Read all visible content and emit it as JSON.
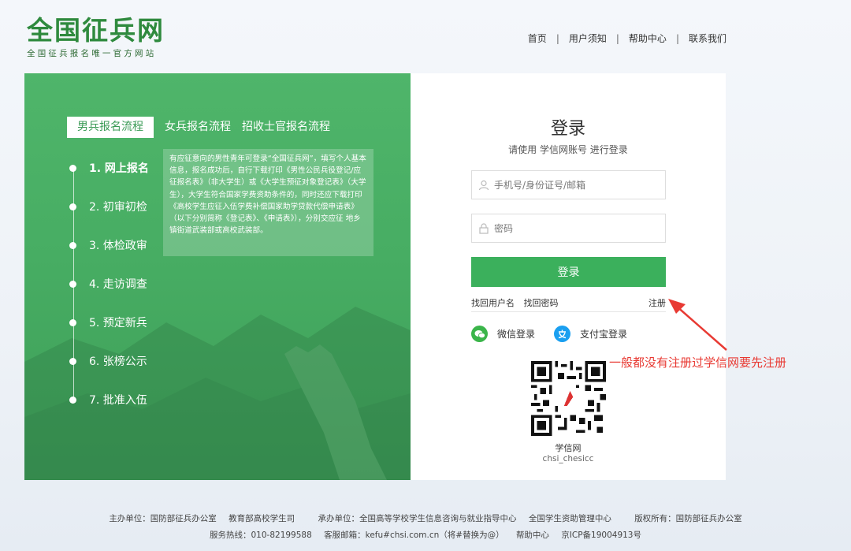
{
  "header": {
    "logo_title": "全国征兵网",
    "logo_sub": "全国征兵报名唯一官方网站",
    "nav": [
      "首页",
      "用户须知",
      "帮助中心",
      "联系我们"
    ],
    "nav_sep": "|"
  },
  "left": {
    "tabs": [
      "男兵报名流程",
      "女兵报名流程",
      "招收士官报名流程"
    ],
    "steps": [
      "1. 网上报名",
      "2. 初审初检",
      "3. 体检政审",
      "4. 走访调查",
      "5. 预定新兵",
      "6. 张榜公示",
      "7. 批准入伍"
    ],
    "info": "有应征意向的男性青年可登录“全国征兵网”，填写个人基本信息，报名成功后，自行下载打印《男性公民兵役登记/应征报名表》（非大学生）或《大学生预征对象登记表》（大学生），大学生符合国家学费资助条件的，同时还应下载打印《高校学生应征入伍学费补偿国家助学贷款代偿申请表》（以下分别简称《登记表》、《申请表》），分别交应征 地乡镇街道武装部或高校武装部。"
  },
  "login": {
    "title": "登录",
    "subtitle": "请使用 学信网账号 进行登录",
    "username_placeholder": "手机号/身份证号/邮箱",
    "password_placeholder": "密码",
    "button": "登录",
    "find_user": "找回用户名",
    "find_password": "找回密码",
    "register": "注册",
    "wechat": "微信登录",
    "alipay": "支付宝登录",
    "qr_name": "学信网",
    "qr_id": "chsi_chesicc"
  },
  "annotation": "一般都没有注册过学信网要先注册",
  "footer": {
    "line1": [
      "主办单位：国防部征兵办公室",
      "教育部高校学生司",
      "承办单位：全国高等学校学生信息咨询与就业指导中心",
      "全国学生资助管理中心",
      "版权所有：国防部征兵办公室"
    ],
    "line2": [
      "服务热线：010-82199588",
      "客服邮箱：kefu#chsi.com.cn（将#替换为@）",
      "帮助中心",
      "京ICP备19004913号"
    ]
  },
  "colors": {
    "brand_green": "#3bb05c",
    "panel_green": "#4fb56a",
    "annotation_red": "#e83a33"
  }
}
